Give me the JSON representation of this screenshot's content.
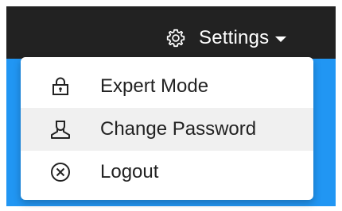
{
  "header": {
    "settings_label": "Settings",
    "settings_icon": "gear-icon"
  },
  "menu": {
    "items": [
      {
        "label": "Expert Mode",
        "icon": "lock-icon"
      },
      {
        "label": "Change Password",
        "icon": "user-icon"
      },
      {
        "label": "Logout",
        "icon": "close-circle-icon"
      }
    ]
  },
  "colors": {
    "topbar": "#222222",
    "accent": "#2196f3",
    "menu_highlight": "#f0f0f0"
  }
}
